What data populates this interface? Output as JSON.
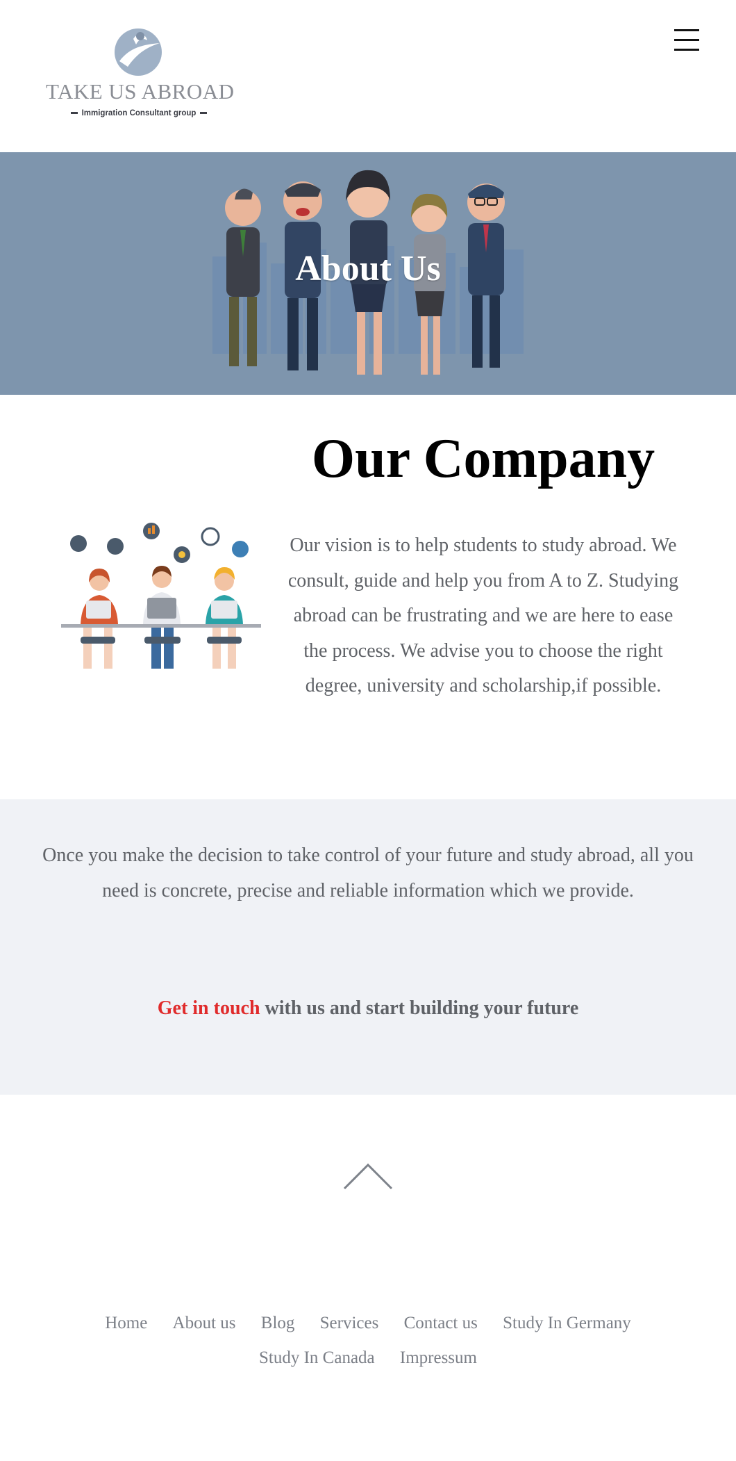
{
  "header": {
    "logo_name": "Take us abroad",
    "logo_tagline": "Immigration Consultant group",
    "menu_icon": "hamburger-menu-icon"
  },
  "hero": {
    "title": "About Us",
    "background": "#7e95ad"
  },
  "company": {
    "title": "Our Company",
    "text": "Our vision is to help students to study abroad. We consult, guide and help you from A to Z. Studying abroad can be frustrating and we are here to ease the process. We advise you to choose the right degree, university and scholarship,if possible."
  },
  "band": {
    "text": "Once you make the decision to take control of your future and study abroad, all you need is concrete, precise and reliable information which we provide.",
    "cta_link": "Get in touch",
    "cta_rest": " with us and start building your future",
    "cta_color": "#e02b2b"
  },
  "footer": {
    "scroll_top_icon": "chevron-up-icon",
    "nav": {
      "home": "Home",
      "about": "About us",
      "blog": "Blog",
      "services": "Services",
      "contact": "Contact us",
      "germany": "Study In Germany",
      "canada": "Study In Canada",
      "impressum": "Impressum"
    }
  }
}
